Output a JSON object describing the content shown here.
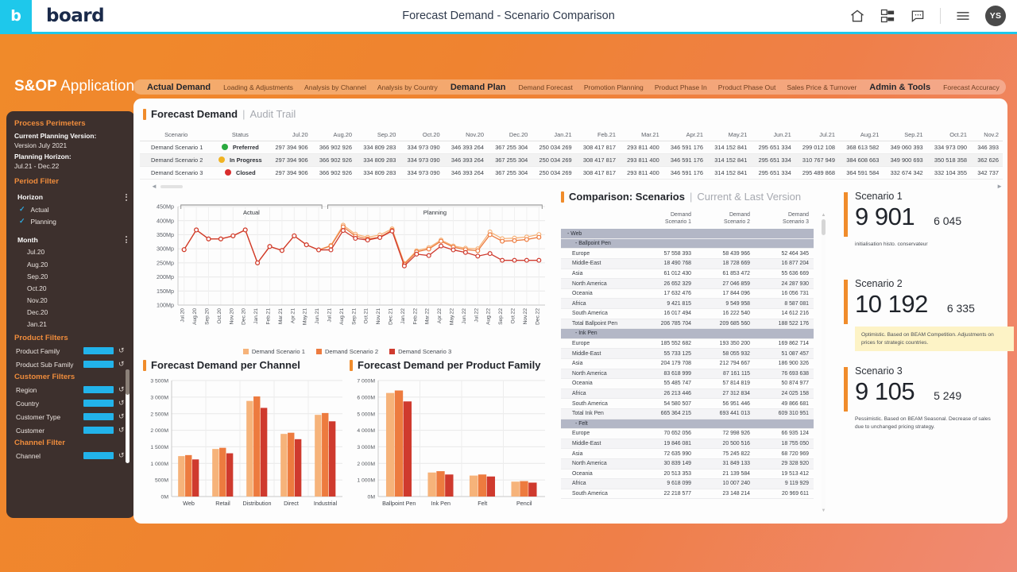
{
  "header": {
    "logo_letter": "b",
    "brand": "board",
    "title": "Forecast Demand - Scenario Comparison",
    "icons": [
      "home-icon",
      "dashboard-icon",
      "comment-icon",
      "menu-icon"
    ],
    "avatar_initials": "YS"
  },
  "app": {
    "title_bold": "S&OP",
    "title_light": "Application"
  },
  "tabs": [
    {
      "label": "Actual Demand",
      "bold": true
    },
    {
      "label": "Loading & Adjustments",
      "bold": false
    },
    {
      "label": "Analysis by Channel",
      "bold": false
    },
    {
      "label": "Analysis by Country",
      "bold": false
    },
    {
      "label": "Demand Plan",
      "bold": true
    },
    {
      "label": "Demand Forecast",
      "bold": false
    },
    {
      "label": "Promotion Planning",
      "bold": false
    },
    {
      "label": "Product Phase In",
      "bold": false
    },
    {
      "label": "Product Phase Out",
      "bold": false
    },
    {
      "label": "Sales Price & Turnover",
      "bold": false
    },
    {
      "label": "Admin & Tools",
      "bold": true
    },
    {
      "label": "Forecast Accuracy",
      "bold": false
    },
    {
      "label": "S&OP Meeting",
      "bold": false
    },
    {
      "label": "Scenario Workflow",
      "bold": false
    }
  ],
  "sidebar": {
    "process_header": "Process Perimeters",
    "planning_version_label": "Current Planning Version:",
    "planning_version_value": "Version July 2021",
    "planning_horizon_label": "Planning Horizon:",
    "planning_horizon_value": "Jul.21 - Dec.22",
    "period_filter_header": "Period Filter",
    "horizon_label": "Horizon",
    "horizon_options": [
      "Actual",
      "Planning"
    ],
    "month_label": "Month",
    "months": [
      "Jul.20",
      "Aug.20",
      "Sep.20",
      "Oct.20",
      "Nov.20",
      "Dec.20",
      "Jan.21"
    ],
    "product_filters_header": "Product Filters",
    "customer_filters_header": "Customer Filters",
    "channel_filter_header": "Channel Filter",
    "filters": [
      {
        "label": "Product Family",
        "group": "product"
      },
      {
        "label": "Product Sub Family",
        "group": "product"
      },
      {
        "label": "Region",
        "group": "customer"
      },
      {
        "label": "Country",
        "group": "customer"
      },
      {
        "label": "Customer Type",
        "group": "customer"
      },
      {
        "label": "Customer",
        "group": "customer"
      },
      {
        "label": "Channel",
        "group": "channel"
      }
    ]
  },
  "audit": {
    "title_main": "Forecast Demand",
    "title_sep": "|",
    "title_sub": "Audit Trail",
    "col_scenario": "Scenario",
    "col_status": "Status",
    "months": [
      "Jul.20",
      "Aug.20",
      "Sep.20",
      "Oct.20",
      "Nov.20",
      "Dec.20",
      "Jan.21",
      "Feb.21",
      "Mar.21",
      "Apr.21",
      "May.21",
      "Jun.21",
      "Jul.21",
      "Aug.21",
      "Sep.21",
      "Oct.21",
      "Nov.2"
    ],
    "rows": [
      {
        "scenario": "Demand Scenario 1",
        "status": "Preferred",
        "status_color": "#2aaa3f",
        "values": [
          "297 394 906",
          "366 902 926",
          "334 809 283",
          "334 973 090",
          "346 393 264",
          "367 255 304",
          "250 034 269",
          "308 417 817",
          "293 811 400",
          "346 591 176",
          "314 152 841",
          "295 651 334",
          "299 012 108",
          "368 613 582",
          "349 060 393",
          "334 973 090",
          "346 393"
        ]
      },
      {
        "scenario": "Demand Scenario 2",
        "status": "In Progress",
        "status_color": "#f0b323",
        "values": [
          "297 394 906",
          "366 902 926",
          "334 809 283",
          "334 973 090",
          "346 393 264",
          "367 255 304",
          "250 034 269",
          "308 417 817",
          "293 811 400",
          "346 591 176",
          "314 152 841",
          "295 651 334",
          "310 767 949",
          "384 608 663",
          "349 900 693",
          "350 518 358",
          "362 626"
        ]
      },
      {
        "scenario": "Demand Scenario 3",
        "status": "Closed",
        "status_color": "#d92d2d",
        "values": [
          "297 394 906",
          "366 902 926",
          "334 809 283",
          "334 973 090",
          "346 393 264",
          "367 255 304",
          "250 034 269",
          "308 417 817",
          "293 811 400",
          "346 591 176",
          "314 152 841",
          "295 651 334",
          "295 489 868",
          "364 591 584",
          "332 674 342",
          "332 104 355",
          "342 737"
        ]
      }
    ]
  },
  "chart_data": [
    {
      "id": "line-chart",
      "type": "line",
      "title": "",
      "xlabel": "",
      "ylabel": "",
      "ylim": [
        100,
        450
      ],
      "ytick_labels": [
        "450Mp",
        "400Mp",
        "350Mp",
        "300Mp",
        "250Mp",
        "200Mp",
        "150Mp",
        "100Mp"
      ],
      "yticks": [
        450,
        400,
        350,
        300,
        250,
        200,
        150,
        100
      ],
      "grid": true,
      "region_labels": [
        "Actual",
        "Planning"
      ],
      "actual_span": [
        0,
        11
      ],
      "planning_span": [
        11,
        29
      ],
      "categories": [
        "Jul.20",
        "Aug.20",
        "Sep.20",
        "Oct.20",
        "Nov.20",
        "Dec.20",
        "Jan.21",
        "Feb.21",
        "Mar.21",
        "Apr.21",
        "May.21",
        "Jun.21",
        "Jul.21",
        "Aug.21",
        "Sep.21",
        "Oct.21",
        "Nov.21",
        "Dec.21",
        "Jan.22",
        "Feb.22",
        "Mar.22",
        "Apr.22",
        "May.22",
        "Jun.22",
        "Jul.22",
        "Aug.22",
        "Sep.22",
        "Oct.22",
        "Nov.22",
        "Dec.22"
      ],
      "series": [
        {
          "name": "Demand Scenario 1",
          "color": "#f6b37a",
          "values": [
            297,
            367,
            335,
            335,
            346,
            367,
            250,
            308,
            294,
            346,
            314,
            296,
            312,
            384,
            352,
            341,
            349,
            371,
            248,
            293,
            304,
            331,
            310,
            302,
            300,
            360,
            336,
            338,
            342,
            351
          ]
        },
        {
          "name": "Demand Scenario 2",
          "color": "#ed7b3f",
          "values": [
            297,
            367,
            335,
            335,
            346,
            367,
            250,
            308,
            294,
            346,
            314,
            296,
            310,
            378,
            345,
            335,
            341,
            366,
            245,
            289,
            299,
            327,
            306,
            297,
            293,
            350,
            327,
            329,
            333,
            341
          ]
        },
        {
          "name": "Demand Scenario 3",
          "color": "#cf3a2e",
          "values": [
            297,
            367,
            335,
            335,
            346,
            367,
            250,
            308,
            294,
            346,
            314,
            296,
            296,
            365,
            337,
            331,
            340,
            363,
            239,
            281,
            276,
            310,
            296,
            287,
            274,
            283,
            259,
            259,
            259,
            259
          ]
        }
      ],
      "legend": [
        "Demand Scenario 1",
        "Demand Scenario 2",
        "Demand Scenario 3"
      ],
      "legend_position": "bottom"
    },
    {
      "id": "channel-chart",
      "type": "bar",
      "title": "Forecast Demand per Channel",
      "categories": [
        "Web",
        "Retail",
        "Distribution",
        "Direct",
        "Industrial"
      ],
      "ylim": [
        0,
        3500
      ],
      "ytick_labels": [
        "3 500M",
        "3 000M",
        "2 500M",
        "2 000M",
        "1 500M",
        "1 000M",
        "500M",
        "0M"
      ],
      "yticks": [
        3500,
        3000,
        2500,
        2000,
        1500,
        1000,
        500,
        0
      ],
      "grid": true,
      "series": [
        {
          "name": "Demand Scenario 1",
          "color": "#f6b37a",
          "values": [
            1220,
            1435,
            2885,
            1890,
            2465
          ]
        },
        {
          "name": "Demand Scenario 2",
          "color": "#ed7b3f",
          "values": [
            1250,
            1470,
            3020,
            1925,
            2520
          ]
        },
        {
          "name": "Demand Scenario 3",
          "color": "#cf3a2e",
          "values": [
            1120,
            1305,
            2675,
            1730,
            2270
          ]
        }
      ]
    },
    {
      "id": "product-family-chart",
      "type": "bar",
      "title": "Forecast Demand per Product Family",
      "categories": [
        "Ballpoint Pen",
        "Ink Pen",
        "Felt",
        "Pencil"
      ],
      "ylim": [
        0,
        7000
      ],
      "ytick_labels": [
        "7 000M",
        "6 000M",
        "5 000M",
        "4 000M",
        "3 000M",
        "2 000M",
        "1 000M",
        "0M"
      ],
      "yticks": [
        7000,
        6000,
        5000,
        4000,
        3000,
        2000,
        1000,
        0
      ],
      "grid": true,
      "series": [
        {
          "name": "Demand Scenario 1",
          "color": "#f6b37a",
          "values": [
            6250,
            1450,
            1265,
            900
          ]
        },
        {
          "name": "Demand Scenario 2",
          "color": "#ed7b3f",
          "values": [
            6400,
            1530,
            1330,
            930
          ]
        },
        {
          "name": "Demand Scenario 3",
          "color": "#cf3a2e",
          "values": [
            5740,
            1330,
            1210,
            840
          ]
        }
      ]
    }
  ],
  "channel_chart": {
    "title_main": "Forecast Demand per Channel"
  },
  "pf_chart": {
    "title_main": "Forecast Demand per Product Family"
  },
  "comparison": {
    "title_main": "Comparison: Scenarios",
    "title_sep": "|",
    "title_sub": "Current & Last Version",
    "headers": [
      "Demand\nScenario 1",
      "Demand\nScenario 2",
      "Demand\nScenario 3"
    ],
    "header1_l1": "Demand",
    "header1_l2": "Scenario 1",
    "header2_l1": "Demand",
    "header2_l2": "Scenario 2",
    "header3_l1": "Demand",
    "header3_l2": "Scenario 3",
    "rows": [
      {
        "type": "group",
        "label": "- Web"
      },
      {
        "type": "group2",
        "label": "- Ballpoint Pen"
      },
      {
        "type": "data",
        "label": "Europe",
        "v": [
          "57 558 393",
          "58 439 966",
          "52 464 345"
        ]
      },
      {
        "type": "data",
        "label": "Middle-East",
        "v": [
          "18 490 768",
          "18 728 669",
          "16 877 204"
        ]
      },
      {
        "type": "data",
        "label": "Asia",
        "v": [
          "61 012 430",
          "61 853 472",
          "55 636 669"
        ]
      },
      {
        "type": "data",
        "label": "North America",
        "v": [
          "26 652 329",
          "27 046 859",
          "24 287 930"
        ]
      },
      {
        "type": "data",
        "label": "Oceania",
        "v": [
          "17 632 476",
          "17 844 096",
          "16 056 731"
        ]
      },
      {
        "type": "data",
        "label": "Africa",
        "v": [
          "9 421 815",
          "9 549 958",
          "8 587 081"
        ]
      },
      {
        "type": "data",
        "label": "South America",
        "v": [
          "16 017 494",
          "16 222 540",
          "14 612 216"
        ]
      },
      {
        "type": "data",
        "label": "Total Ballpoint Pen",
        "v": [
          "206 785 704",
          "209 685 560",
          "188 522 176"
        ]
      },
      {
        "type": "group2",
        "label": "- Ink Pen"
      },
      {
        "type": "data",
        "label": "Europe",
        "v": [
          "185 552 682",
          "193 350 200",
          "169 862 714"
        ]
      },
      {
        "type": "data",
        "label": "Middle-East",
        "v": [
          "55 733 125",
          "58 055 932",
          "51 087 457"
        ]
      },
      {
        "type": "data",
        "label": "Asia",
        "v": [
          "204 179 708",
          "212 794 667",
          "186 900 326"
        ]
      },
      {
        "type": "data",
        "label": "North America",
        "v": [
          "83 618 999",
          "87 161 115",
          "76 693 638"
        ]
      },
      {
        "type": "data",
        "label": "Oceania",
        "v": [
          "55 485 747",
          "57 814 819",
          "50 874 977"
        ]
      },
      {
        "type": "data",
        "label": "Africa",
        "v": [
          "26 213 446",
          "27 312 834",
          "24 025 158"
        ]
      },
      {
        "type": "data",
        "label": "South America",
        "v": [
          "54 580 507",
          "56 951 446",
          "49 866 681"
        ]
      },
      {
        "type": "data",
        "label": "Total Ink Pen",
        "v": [
          "665 364 215",
          "693 441 013",
          "609 310 951"
        ]
      },
      {
        "type": "group2",
        "label": "- Felt"
      },
      {
        "type": "data",
        "label": "Europe",
        "v": [
          "70 652 056",
          "72 998 926",
          "66 935 124"
        ]
      },
      {
        "type": "data",
        "label": "Middle-East",
        "v": [
          "19 846 081",
          "20 500 516",
          "18 755 050"
        ]
      },
      {
        "type": "data",
        "label": "Asia",
        "v": [
          "72 635 990",
          "75 245 822",
          "68 720 969"
        ]
      },
      {
        "type": "data",
        "label": "North America",
        "v": [
          "30 839 149",
          "31 849 133",
          "29 328 920"
        ]
      },
      {
        "type": "data",
        "label": "Oceania",
        "v": [
          "20 513 353",
          "21 139 584",
          "19 513 412"
        ]
      },
      {
        "type": "data",
        "label": "Africa",
        "v": [
          "9 618 099",
          "10 007 240",
          "9 119 929"
        ]
      },
      {
        "type": "data",
        "label": "South America",
        "v": [
          "22 218 577",
          "23 148 214",
          "20 969 611"
        ]
      }
    ]
  },
  "scenarios": [
    {
      "name": "Scenario 1",
      "big": "9 901",
      "small": "6 045",
      "note": "initialisation histo. conservateur",
      "highlight": false
    },
    {
      "name": "Scenario 2",
      "big": "10 192",
      "small": "6 335",
      "note": "Optimistic. Based on BEAM Competition. Adjustments on prices for strategic countries.",
      "highlight": true
    },
    {
      "name": "Scenario 3",
      "big": "9 105",
      "small": "5 249",
      "note": "Pessimistic. Based on BEAM Seasonal. Decrease of sales due to unchanged pricing strategy.",
      "highlight": false
    }
  ]
}
